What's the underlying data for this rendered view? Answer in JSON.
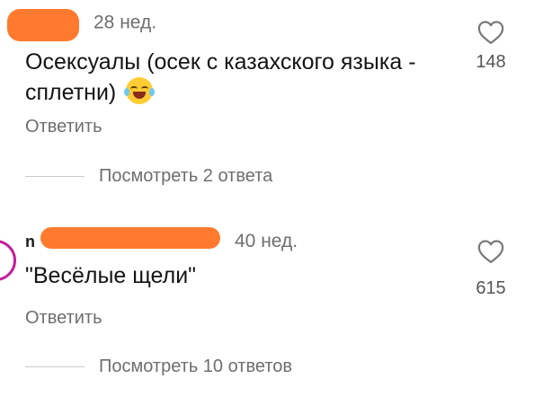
{
  "comments": [
    {
      "time_ago": "28 нед.",
      "text": "Осексуалы (осек с казахского языка - сплетни)",
      "emoji": "laughing-with-tears",
      "reply_label": "Ответить",
      "view_replies_label": "Посмотреть 2 ответа",
      "likes": "148"
    },
    {
      "username_initial": "n",
      "time_ago": "40 нед.",
      "text": "\"Весёлые щели\"",
      "reply_label": "Ответить",
      "view_replies_label": "Посмотреть 10 ответов",
      "likes": "615"
    }
  ],
  "colors": {
    "redaction": "#ff7a2e",
    "avatar_ring": "#c21f9b",
    "secondary_text": "#6e6e6e"
  },
  "icons": {
    "like": "heart-outline-icon"
  }
}
